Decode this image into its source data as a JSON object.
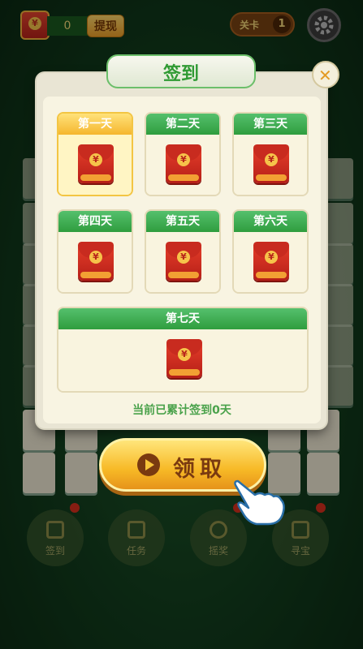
{
  "header": {
    "coin_symbol": "¥",
    "balance": "0",
    "withdraw_label": "提现",
    "level_label": "关卡",
    "level_number": "1",
    "settings_icon": "gear-icon"
  },
  "bottom_menu": [
    {
      "label": "签到",
      "icon": "calendar-check-icon",
      "badge": true
    },
    {
      "label": "任务",
      "icon": "clipboard-icon",
      "badge": false
    },
    {
      "label": "摇奖",
      "icon": "camera-dial-icon",
      "badge": true
    },
    {
      "label": "寻宝",
      "icon": "treasure-chest-icon",
      "badge": true
    }
  ],
  "dialog": {
    "title": "签到",
    "close_icon": "close-icon",
    "days": [
      {
        "label": "第一天",
        "today": true
      },
      {
        "label": "第二天",
        "today": false
      },
      {
        "label": "第三天",
        "today": false
      },
      {
        "label": "第四天",
        "today": false
      },
      {
        "label": "第五天",
        "today": false
      },
      {
        "label": "第六天",
        "today": false
      },
      {
        "label": "第七天",
        "today": false
      }
    ],
    "reward_icon": "red-envelope-icon",
    "envelope_symbol": "¥",
    "summary": "当前已累计签到0天",
    "claim_label": "领取",
    "claim_icon": "play-icon"
  },
  "colors": {
    "accent_green": "#2f9d3e",
    "gold": "#f7b926",
    "envelope_red": "#d3301f"
  }
}
